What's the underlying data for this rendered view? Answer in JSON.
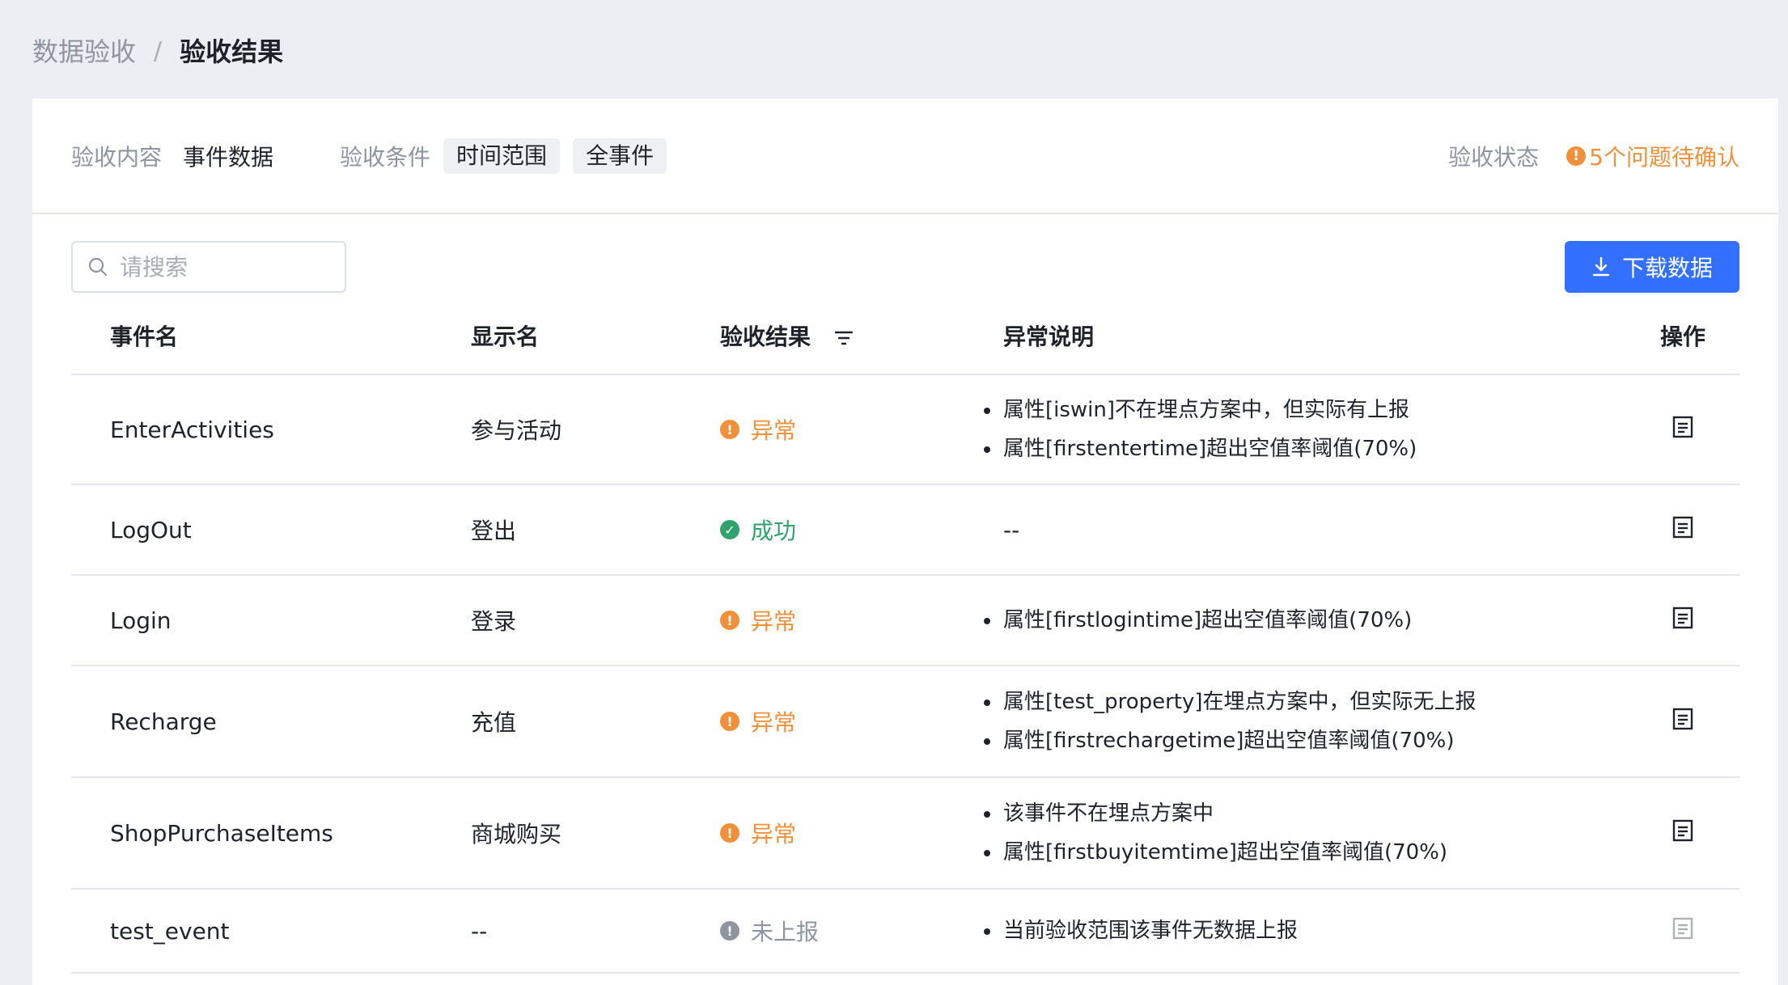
{
  "breadcrumb": {
    "parent": "数据验收",
    "separator": "/",
    "current": "验收结果"
  },
  "info": {
    "content_label": "验收内容",
    "content_value": "事件数据",
    "condition_label": "验收条件",
    "condition_tags": [
      "时间范围",
      "全事件"
    ],
    "status_label": "验收状态",
    "status_value": "5个问题待确认"
  },
  "toolbar": {
    "search_placeholder": "请搜索",
    "download_label": "下载数据"
  },
  "table": {
    "headers": {
      "event_name": "事件名",
      "display_name": "显示名",
      "result": "验收结果",
      "description": "异常说明",
      "operation": "操作"
    },
    "rows": [
      {
        "event_name": "EnterActivities",
        "display_name": "参与活动",
        "result": "异常",
        "result_type": "abnormal",
        "descriptions": [
          "属性[iswin]不在埋点方案中，但实际有上报",
          "属性[firstentertime]超出空值率阈值(70%)"
        ]
      },
      {
        "event_name": "LogOut",
        "display_name": "登出",
        "result": "成功",
        "result_type": "success",
        "descriptions": [],
        "description_empty": "--"
      },
      {
        "event_name": "Login",
        "display_name": "登录",
        "result": "异常",
        "result_type": "abnormal",
        "descriptions": [
          "属性[firstlogintime]超出空值率阈值(70%)"
        ]
      },
      {
        "event_name": "Recharge",
        "display_name": "充值",
        "result": "异常",
        "result_type": "abnormal",
        "descriptions": [
          "属性[test_property]在埋点方案中，但实际无上报",
          "属性[firstrechargetime]超出空值率阈值(70%)"
        ]
      },
      {
        "event_name": "ShopPurchaseItems",
        "display_name": "商城购买",
        "result": "异常",
        "result_type": "abnormal",
        "descriptions": [
          "该事件不在埋点方案中",
          "属性[firstbuyitemtime]超出空值率阈值(70%)"
        ]
      },
      {
        "event_name": "test_event",
        "display_name": "--",
        "result": "未上报",
        "result_type": "unreported",
        "descriptions": [
          "当前验收范围该事件无数据上报"
        ]
      }
    ]
  },
  "colors": {
    "accent": "#3370ff",
    "warning": "#f0903a",
    "success": "#2fa36b",
    "muted": "#8f959e"
  }
}
